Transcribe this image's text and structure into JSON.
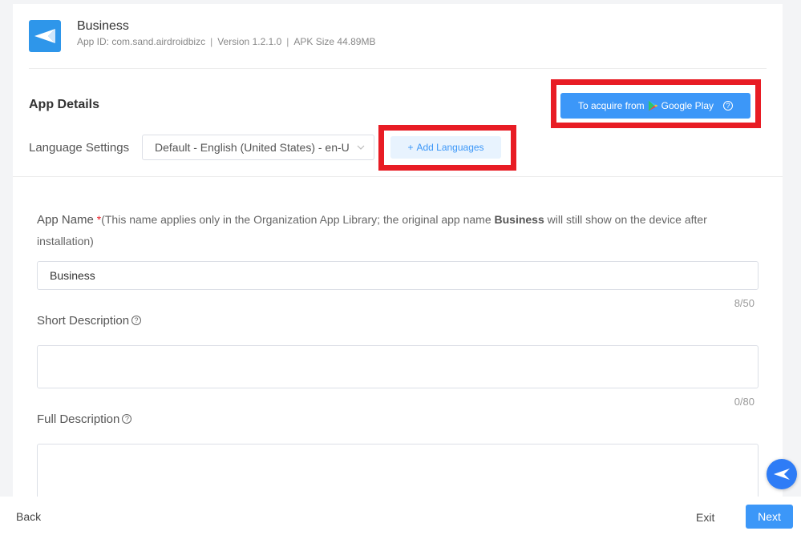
{
  "app": {
    "name": "Business",
    "id_text": "App ID: com.sand.airdroidbizc",
    "version_text": "Version 1.2.1.0",
    "apk_size_text": "APK Size 44.89MB",
    "separator": "|"
  },
  "details": {
    "title": "App Details",
    "google_play_prefix": "To acquire from",
    "google_play_label": "Google Play",
    "help_glyph": "?",
    "language_label": "Language Settings",
    "language_value": "Default - English (United States) - en-U",
    "add_languages_label": "Add Languages",
    "add_glyph": "+"
  },
  "form": {
    "app_name_label": "App Name",
    "required_mark": "*",
    "app_name_note_before": "(This name applies only in the Organization App Library; the original app name ",
    "app_name_note_bold": "Business",
    "app_name_note_after": " will still show on the device after installation)",
    "app_name_value": "Business",
    "app_name_counter": "8/50",
    "short_desc_label": "Short Description",
    "short_desc_value": "",
    "short_desc_counter": "0/80",
    "full_desc_label": "Full Description",
    "full_desc_value": ""
  },
  "footer": {
    "back_label": "Back",
    "exit_label": "Exit",
    "next_label": "Next"
  },
  "colors": {
    "accent": "#3c97f8",
    "highlight_box": "#e81c24",
    "app_icon_bg": "#2e96ea"
  },
  "icons": {
    "app_icon": "paper-plane-icon",
    "google_play": "google-play-icon",
    "help": "question-circle-icon",
    "select_arrow": "chevron-down-icon",
    "add": "plus-icon",
    "floating_button": "paper-plane-icon"
  }
}
